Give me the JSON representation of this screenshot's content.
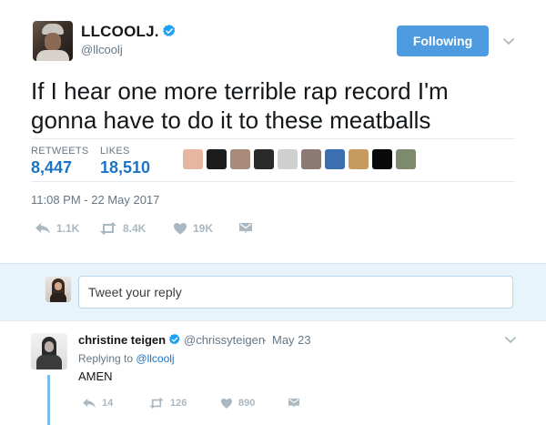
{
  "tweet": {
    "display_name": "LLCOOLJ.",
    "handle": "@llcoolj",
    "follow_label": "Following",
    "text_line1": "If I hear one more terrible rap record I'm",
    "text_line2": "gonna have to do it to these meatballs",
    "stats": {
      "retweets_label": "RETWEETS",
      "retweets_value": "8,447",
      "likes_label": "LIKES",
      "likes_value": "18,510"
    },
    "likers_colors": [
      "#e7b6a3",
      "#1c1c1c",
      "#a88b78",
      "#2a2a2a",
      "#cfcfcf",
      "#8e7a74",
      "#3b6fb0",
      "#c79a5f",
      "#0a0a0a",
      "#7d8a6d"
    ],
    "timestamp": "11:08 PM - 22 May 2017",
    "actions": {
      "replies": "1.1K",
      "retweets": "8.4K",
      "likes": "19K"
    }
  },
  "reply_box": {
    "placeholder": "Tweet your reply"
  },
  "reply": {
    "display_name": "christine teigen",
    "handle": "@chrissyteigen",
    "separator": "·",
    "date": "May 23",
    "replying_prefix": "Replying to",
    "replying_handle": "@llcoolj",
    "text": "AMEN",
    "actions": {
      "replies": "14",
      "retweets": "126",
      "likes": "890"
    }
  },
  "colors": {
    "accent": "#1b74c5",
    "follow_button": "#4f9be0",
    "muted": "#657786",
    "reply_box_bg": "#e8f4fb",
    "thread_line": "#7bbce4"
  },
  "icons": {
    "verified": "verified-badge-icon",
    "chevron": "chevron-down-icon",
    "reply": "reply-arrow-icon",
    "retweet": "retweet-icon",
    "like": "heart-icon",
    "dm": "envelope-icon"
  }
}
